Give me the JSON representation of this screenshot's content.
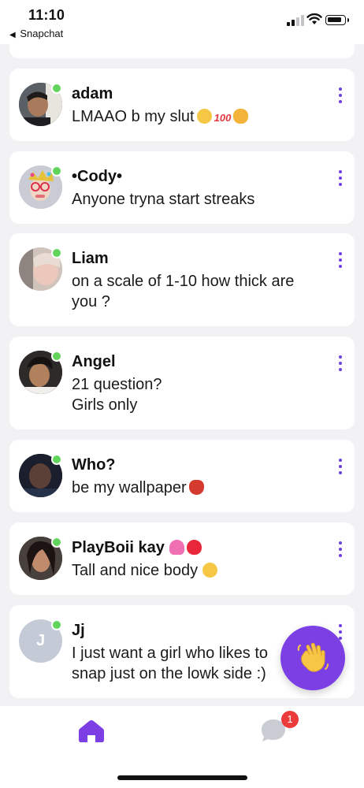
{
  "status_bar": {
    "time": "11:10",
    "back_label": "Snapchat",
    "back_icon": "back-triangle-icon",
    "signal_icon": "cellular-signal-icon",
    "wifi_icon": "wifi-icon",
    "battery_icon": "battery-icon"
  },
  "colors": {
    "accent": "#7b3fe4",
    "online": "#62d45c",
    "badge": "#ec3b3b",
    "background": "#f2f2f4"
  },
  "conversations": [
    {
      "name": "adam",
      "message": "LMAAO b my slut",
      "emojis": [
        "eye-roll-emoji",
        "hundred-emoji",
        "smirk-cat-emoji"
      ],
      "online": true
    },
    {
      "name": "•Cody•",
      "message": "Anyone tryna start streaks",
      "emojis": [],
      "online": true
    },
    {
      "name": "Liam",
      "message": "on a scale of 1-10 how thick are you ?",
      "emojis": [],
      "online": true
    },
    {
      "name": "Angel",
      "message": "21 question?\nGirls only",
      "emojis": [],
      "online": true
    },
    {
      "name": "Who?",
      "message": "be my wallpaper",
      "emojis": [
        "tengu-mask-emoji"
      ],
      "online": true
    },
    {
      "name": "PlayBoii kay",
      "name_emojis": [
        "two-hearts-emoji",
        "kiss-mark-emoji"
      ],
      "message": "Tall and nice body",
      "emojis": [
        "woozy-face-emoji"
      ],
      "online": true
    },
    {
      "name": "Jj",
      "avatar_initial": "J",
      "message": "I just want a girl who likes to snap just on the lowk side :)",
      "emojis": [],
      "online": true
    }
  ],
  "more_icon": "more-vertical-icon",
  "wave_button": {
    "icon": "waving-hand-icon"
  },
  "tab_bar": {
    "home_icon": "home-icon",
    "chat_icon": "chat-bubble-icon",
    "chat_badge": "1"
  }
}
